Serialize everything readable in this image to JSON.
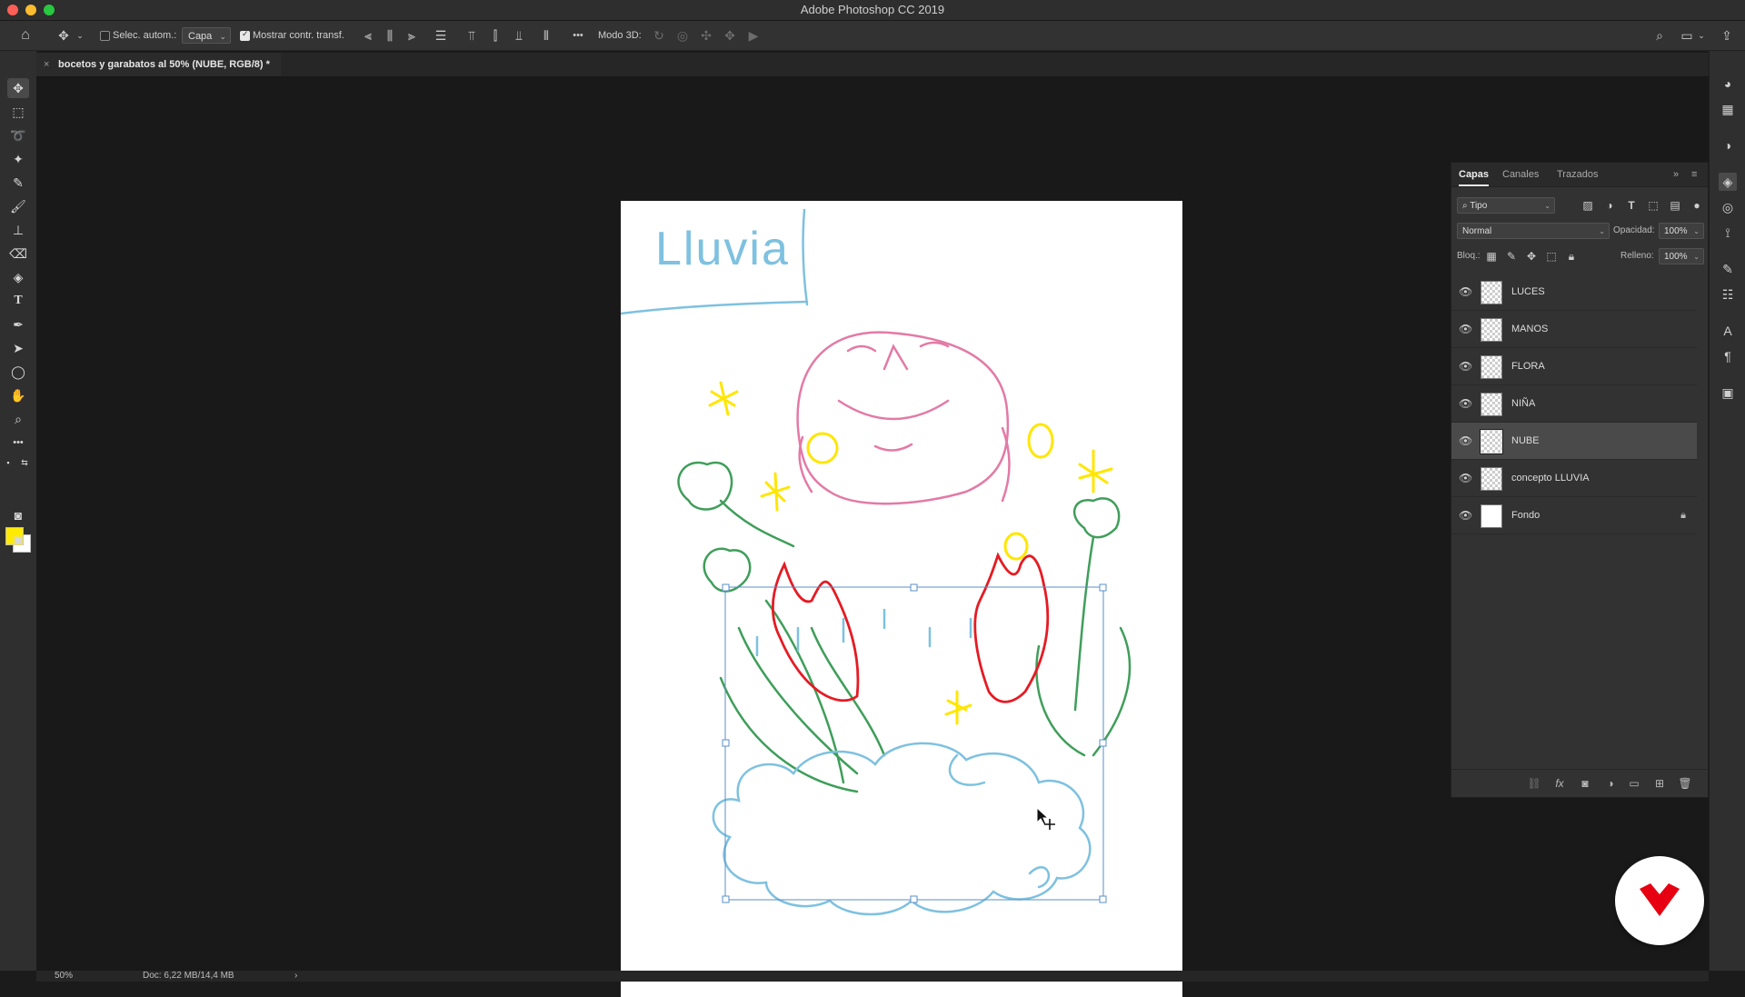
{
  "window": {
    "title": "Adobe Photoshop CC 2019"
  },
  "colors": {
    "accent": "#e8e8e8",
    "foreground": "#ffea00",
    "background": "#ffffff",
    "logo": "#e60012"
  },
  "options_bar": {
    "auto_select_label": "Selec. autom.:",
    "auto_select_checked": false,
    "target_value": "Capa",
    "show_transform_label": "Mostrar contr. transf.",
    "show_transform_checked": true,
    "mode3d_label": "Modo 3D:",
    "more": "•••"
  },
  "document_tab": {
    "title": "bocetos y garabatos al 50% (NUBE, RGB/8) *",
    "close": "×"
  },
  "canvas": {
    "heading_text": "Lluvia"
  },
  "layers_panel": {
    "tabs": [
      "Capas",
      "Canales",
      "Trazados"
    ],
    "active_tab": "Capas",
    "filter_value": "Tipo",
    "blend_mode": "Normal",
    "opacity_label": "Opacidad:",
    "opacity_value": "100%",
    "lock_label": "Bloq.:",
    "fill_label": "Relleno:",
    "fill_value": "100%",
    "layers": [
      {
        "name": "LUCES",
        "visible": true,
        "selected": false,
        "locked": false
      },
      {
        "name": "MANOS",
        "visible": true,
        "selected": false,
        "locked": false
      },
      {
        "name": "FLORA",
        "visible": true,
        "selected": false,
        "locked": false
      },
      {
        "name": "NIÑA",
        "visible": true,
        "selected": false,
        "locked": false
      },
      {
        "name": "NUBE",
        "visible": true,
        "selected": true,
        "locked": false
      },
      {
        "name": "concepto LLUVIA",
        "visible": true,
        "selected": false,
        "locked": false
      },
      {
        "name": "Fondo",
        "visible": true,
        "selected": false,
        "locked": true
      }
    ]
  },
  "status_bar": {
    "zoom": "50%",
    "doc_size": "Doc: 6,22 MB/14,4 MB",
    "arrow": "›"
  }
}
